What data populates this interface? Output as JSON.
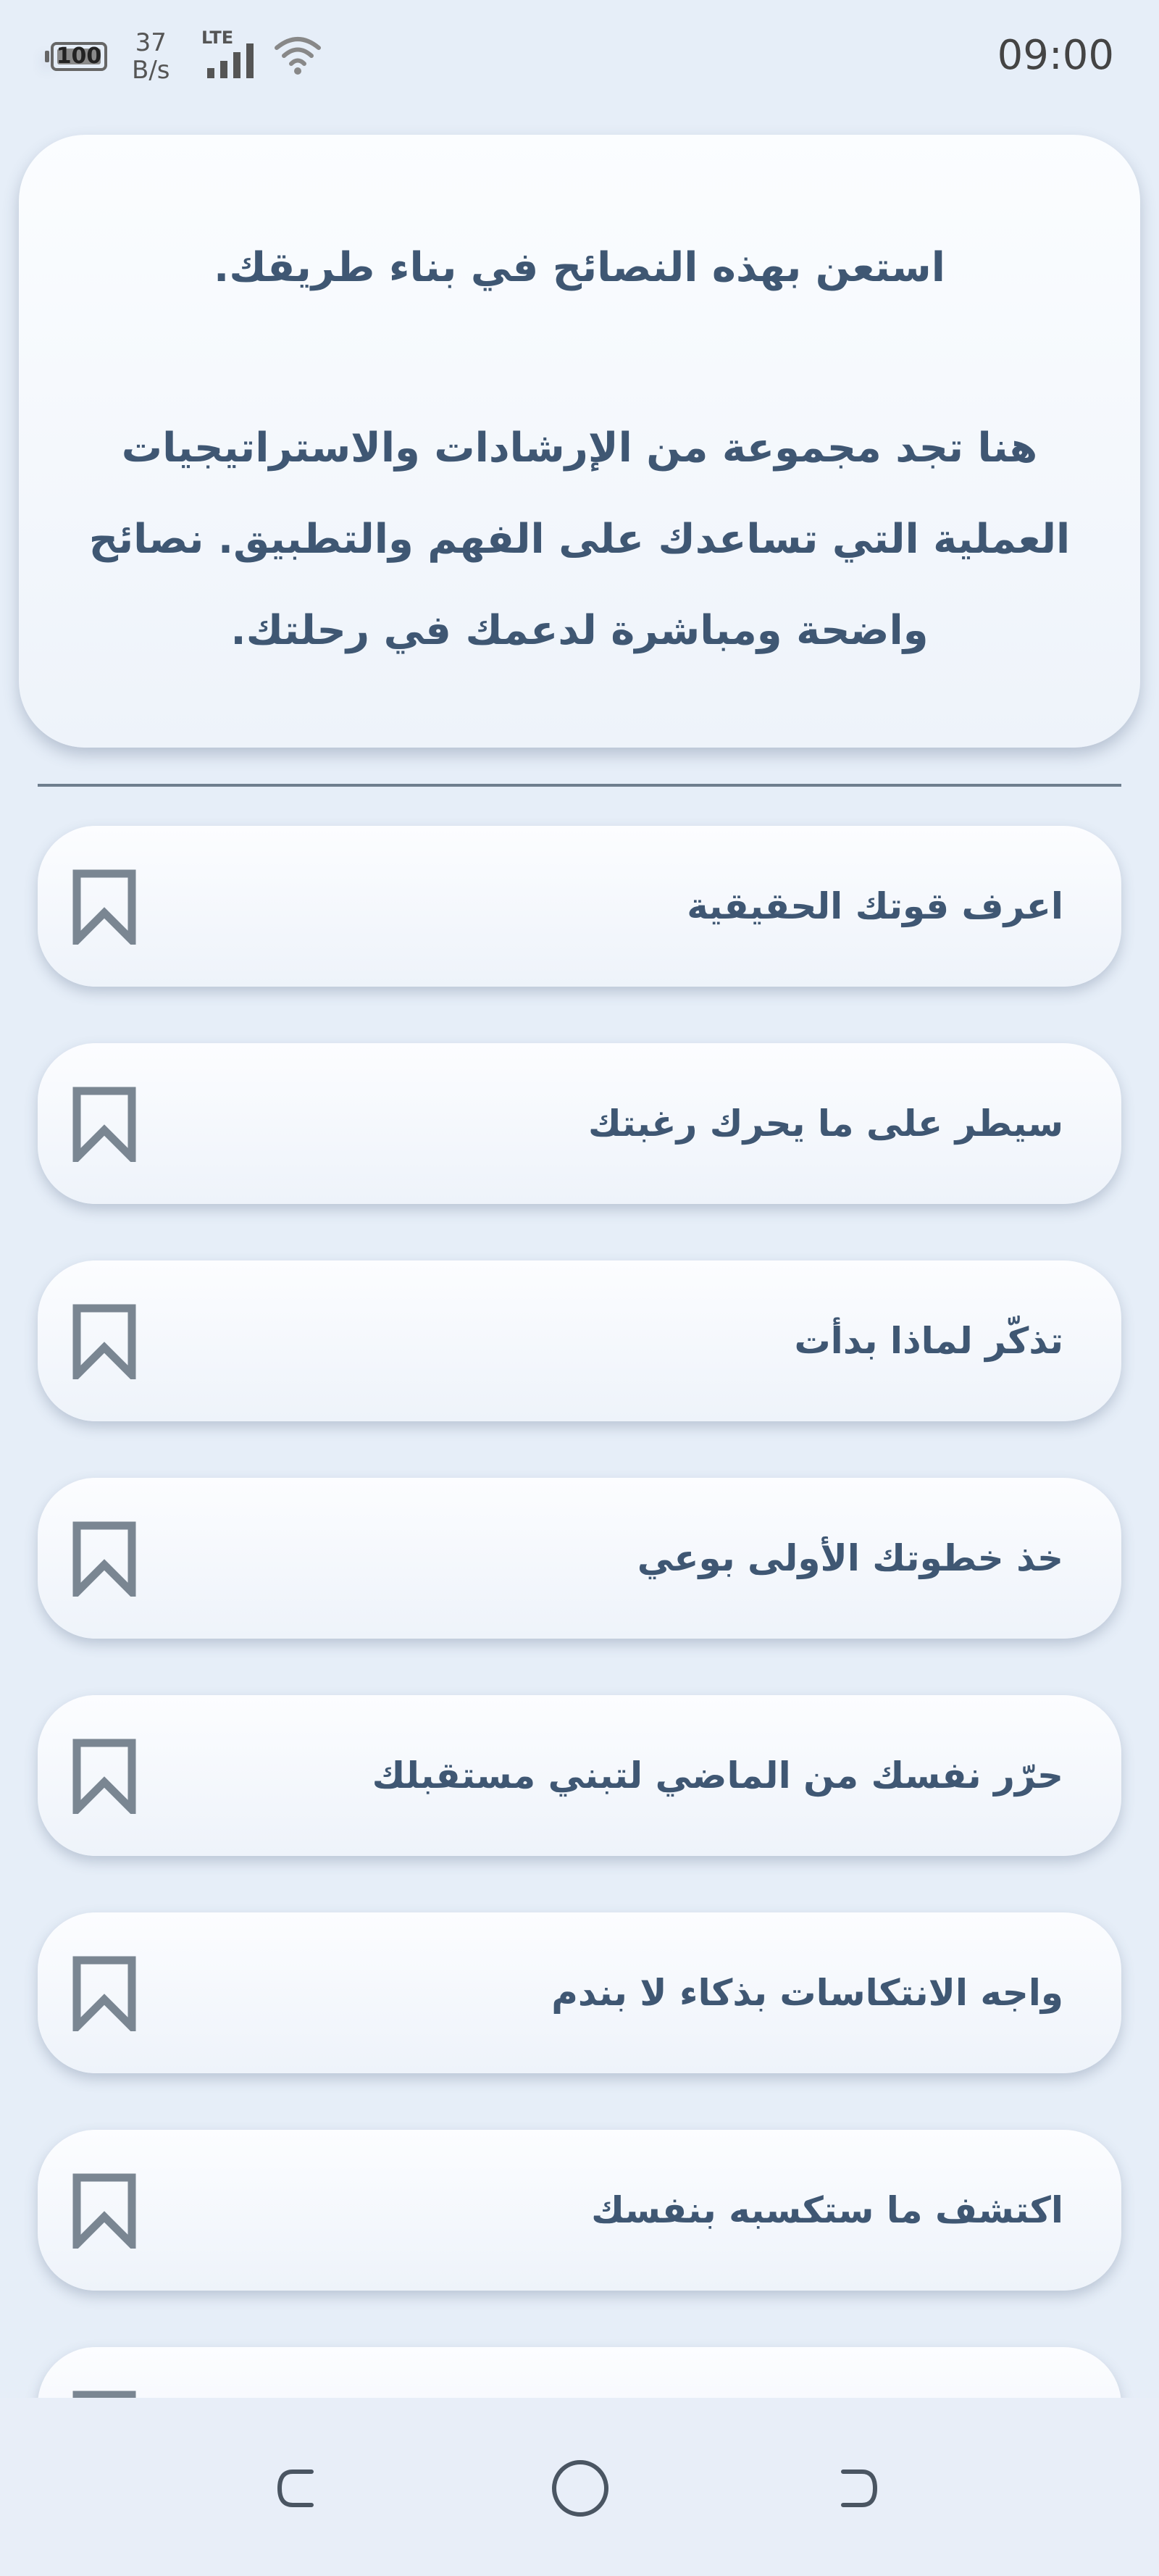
{
  "status_bar": {
    "battery": "100",
    "net_speed_value": "37",
    "net_speed_unit": "B/s",
    "network_type": "LTE",
    "time": "09:00"
  },
  "intro": {
    "line1": "استعن بهذه النصائح في بناء طريقك.",
    "line2": "هنا تجد مجموعة من الإرشادات والاستراتيجيات العملية التي تساعدك على الفهم والتطبيق. نصائح واضحة ومباشرة لدعمك في رحلتك."
  },
  "tips": [
    {
      "label": "اعرف قوتك الحقيقية"
    },
    {
      "label": "سيطر على ما يحرك رغبتك"
    },
    {
      "label": "تذكّر لماذا بدأت"
    },
    {
      "label": "خذ خطوتك الأولى بوعي"
    },
    {
      "label": "حرّر نفسك من الماضي لتبني مستقبلك"
    },
    {
      "label": "واجه الانتكاسات بذكاء لا بندم"
    },
    {
      "label": "اكتشف ما ستكسبه بنفسك"
    },
    {
      "label": ""
    }
  ],
  "icons": {
    "bookmark": "bookmark-outline-icon",
    "nav_back": "back-icon",
    "nav_home": "home-icon",
    "nav_recents": "recents-icon"
  },
  "colors": {
    "background": "#E6EEF8",
    "text": "#3F5773",
    "icon": "#7A8692"
  }
}
